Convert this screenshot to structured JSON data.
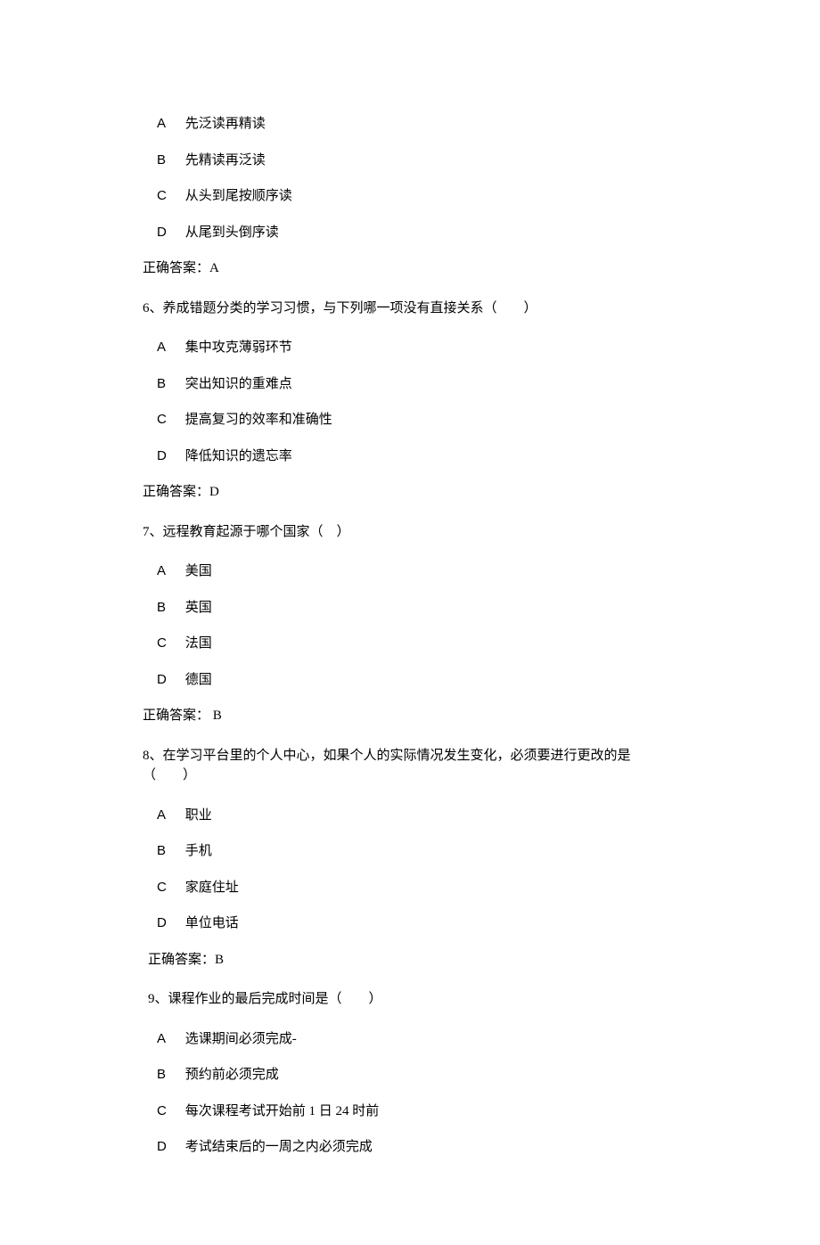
{
  "q5": {
    "options": [
      {
        "letter": "A",
        "text": "先泛读再精读"
      },
      {
        "letter": "B",
        "text": "先精读再泛读"
      },
      {
        "letter": "C",
        "text": "从头到尾按顺序读"
      },
      {
        "letter": "D",
        "text": "从尾到头倒序读"
      }
    ],
    "answer": "正确答案：A"
  },
  "q6": {
    "stem": "6、养成错题分类的学习习惯，与下列哪一项没有直接关系（　　）",
    "options": [
      {
        "letter": "A",
        "text": "集中攻克薄弱环节"
      },
      {
        "letter": "B",
        "text": "突出知识的重难点"
      },
      {
        "letter": "C",
        "text": "提高复习的效率和准确性"
      },
      {
        "letter": "D",
        "text": "降低知识的遗忘率"
      }
    ],
    "answer": "正确答案：D"
  },
  "q7": {
    "stem": "7、远程教育起源于哪个国家（　）",
    "options": [
      {
        "letter": "A",
        "text": "美国"
      },
      {
        "letter": "B",
        "text": "英国"
      },
      {
        "letter": "C",
        "text": "法国"
      },
      {
        "letter": "D",
        "text": "德国"
      }
    ],
    "answer": "正确答案： B"
  },
  "q8": {
    "stem": "8、在学习平台里的个人中心，如果个人的实际情况发生变化，必须要进行更改的是（　　）",
    "options": [
      {
        "letter": "A",
        "text": "职业"
      },
      {
        "letter": "B",
        "text": "手机"
      },
      {
        "letter": "C",
        "text": "家庭住址"
      },
      {
        "letter": "D",
        "text": "单位电话"
      }
    ],
    "answer": "正确答案：B"
  },
  "q9": {
    "stem": "9、课程作业的最后完成时间是（　　）",
    "options": [
      {
        "letter": "A",
        "text": "选课期间必须完成-"
      },
      {
        "letter": "B",
        "text": "预约前必须完成"
      },
      {
        "letter": "C",
        "text": "每次课程考试开始前 1 日 24 时前"
      },
      {
        "letter": "D",
        "text": "考试结束后的一周之内必须完成"
      }
    ]
  }
}
